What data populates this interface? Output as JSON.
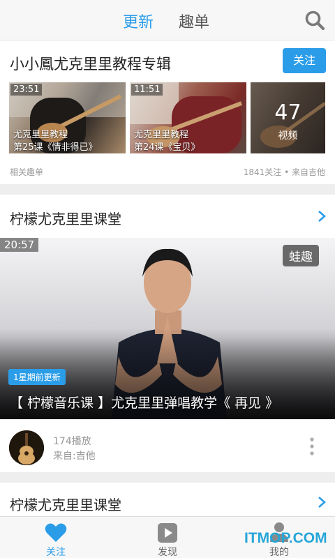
{
  "header": {
    "tabs": [
      {
        "label": "更新",
        "active": true
      },
      {
        "label": "趣单",
        "active": false
      }
    ],
    "search_icon": "search-icon"
  },
  "collection": {
    "title": "小小鳳尤克里里教程专辑",
    "follow_label": "关注",
    "thumbnails": [
      {
        "duration": "23:51",
        "line1": "尤克里里教程",
        "line2": "第25课《情非得已》"
      },
      {
        "duration": "11:51",
        "line1": "尤克里里教程",
        "line2": "第24课《宝贝》"
      },
      {
        "count": "47",
        "count_label": "视频"
      }
    ],
    "footer_left": "相关趣单",
    "footer_right": "1841关注 • 来自吉他"
  },
  "channel": {
    "title": "柠檬尤克里里课堂",
    "video": {
      "duration": "20:57",
      "brand": "蛙趣",
      "update_badge": "1星期前更新",
      "title": "【 柠檬音乐课 】尤克里里弹唱教学《 再见 》"
    },
    "plays": "174播放",
    "source": "来自:吉他"
  },
  "channel2": {
    "title": "柠檬尤克里里课堂"
  },
  "bottom_nav": [
    {
      "label": "关注",
      "icon": "heart-icon",
      "active": true
    },
    {
      "label": "发现",
      "icon": "play-icon",
      "active": false
    },
    {
      "label": "我的",
      "icon": "user-icon",
      "active": false
    }
  ],
  "watermark": "ITMOP.COM",
  "colors": {
    "accent": "#2b9de8",
    "text": "#222222",
    "muted": "#999999"
  }
}
